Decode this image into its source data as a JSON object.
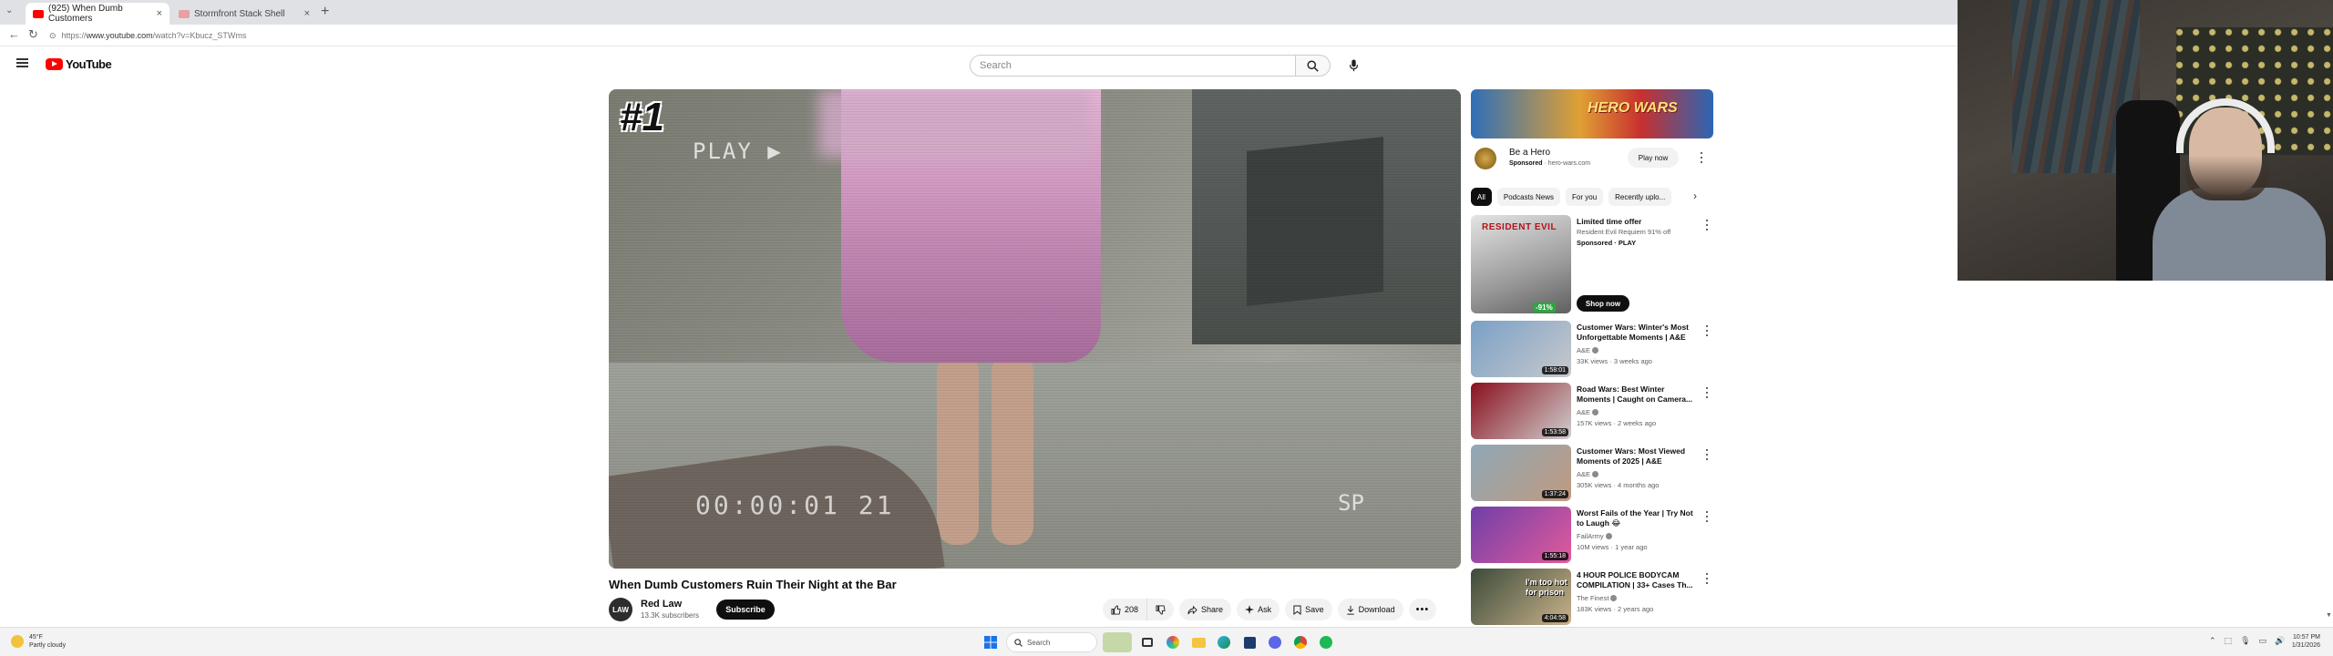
{
  "browser": {
    "tabs": [
      {
        "title": "(925) When Dumb Customers",
        "active": true,
        "favicon_color": "#ff0000"
      },
      {
        "title": "Stormfront Stack Shell",
        "active": false,
        "favicon_color": "#e8a0a0"
      }
    ],
    "url_prefix": "https://",
    "url_domain": "www.youtube.com",
    "url_path": "/watch?v=Kbucz_STWms"
  },
  "youtube": {
    "logo_text": "YouTube",
    "search_placeholder": "Search"
  },
  "video": {
    "badge": "#1",
    "overlay_play": "PLAY ▶",
    "overlay_timestamp": "00:00:01 21",
    "overlay_mode": "SP",
    "title": "When Dumb Customers Ruin Their Night at the Bar",
    "channel": {
      "name": "Red Law",
      "subscribers": "13.3K subscribers",
      "avatar_text": "LAW"
    },
    "subscribe_label": "Subscribe",
    "actions": {
      "like_count": "208",
      "share": "Share",
      "ask": "Ask",
      "save": "Save",
      "download": "Download"
    }
  },
  "ad": {
    "banner_text": "HERO WARS",
    "title": "Be a Hero",
    "sponsored": "Sponsored",
    "domain": "hero-wars.com",
    "cta": "Play now"
  },
  "chips": [
    "All",
    "Podcasts News",
    "For you",
    "Recently uplo..."
  ],
  "recommendations": [
    {
      "title": "Limited time offer",
      "line2": "Resident Evil Requiem 91% off",
      "sponsored": "Sponsored · PLAY",
      "cta": "Shop now",
      "discount": "-91%",
      "thumb_colors": [
        "#d9d9d9",
        "#8c8c8c"
      ],
      "thumb_text": "RESIDENT EVIL"
    },
    {
      "title": "Customer Wars: Winter's Most Unforgettable Moments | A&E",
      "channel": "A&E",
      "meta": "33K views · 3 weeks ago",
      "duration": "1:58:01",
      "thumb_colors": [
        "#7aa0c6",
        "#c7c9cc"
      ]
    },
    {
      "title": "Road Wars: Best Winter Moments | Caught on Camera...",
      "channel": "A&E",
      "meta": "157K views · 2 weeks ago",
      "duration": "1:53:58",
      "thumb_colors": [
        "#8a0f1d",
        "#cfcfcf"
      ]
    },
    {
      "title": "Customer Wars: Most Viewed Moments of 2025 | A&E",
      "channel": "A&E",
      "meta": "305K views · 4 months ago",
      "duration": "1:37:24",
      "thumb_colors": [
        "#8fa8b6",
        "#c09a80"
      ]
    },
    {
      "title": "Worst Fails of the Year | Try Not to Laugh 😂",
      "channel": "FailArmy",
      "meta": "10M views · 1 year ago",
      "duration": "1:55:18",
      "thumb_colors": [
        "#6e3fa8",
        "#e35a9c"
      ]
    },
    {
      "title": "4 HOUR POLICE BODYCAM COMPILATION | 33+ Cases Th...",
      "channel": "The Finest",
      "meta": "183K views · 2 years ago",
      "duration": "4:04:58",
      "thumb_colors": [
        "#3c4a3a",
        "#c9b28a"
      ],
      "thumb_text": "I'm too hot for prison"
    }
  ],
  "taskbar": {
    "weather_temp": "45°F",
    "weather_desc": "Partly cloudy",
    "search_label": "Search",
    "time": "10:57 PM",
    "date": "1/31/2026"
  }
}
